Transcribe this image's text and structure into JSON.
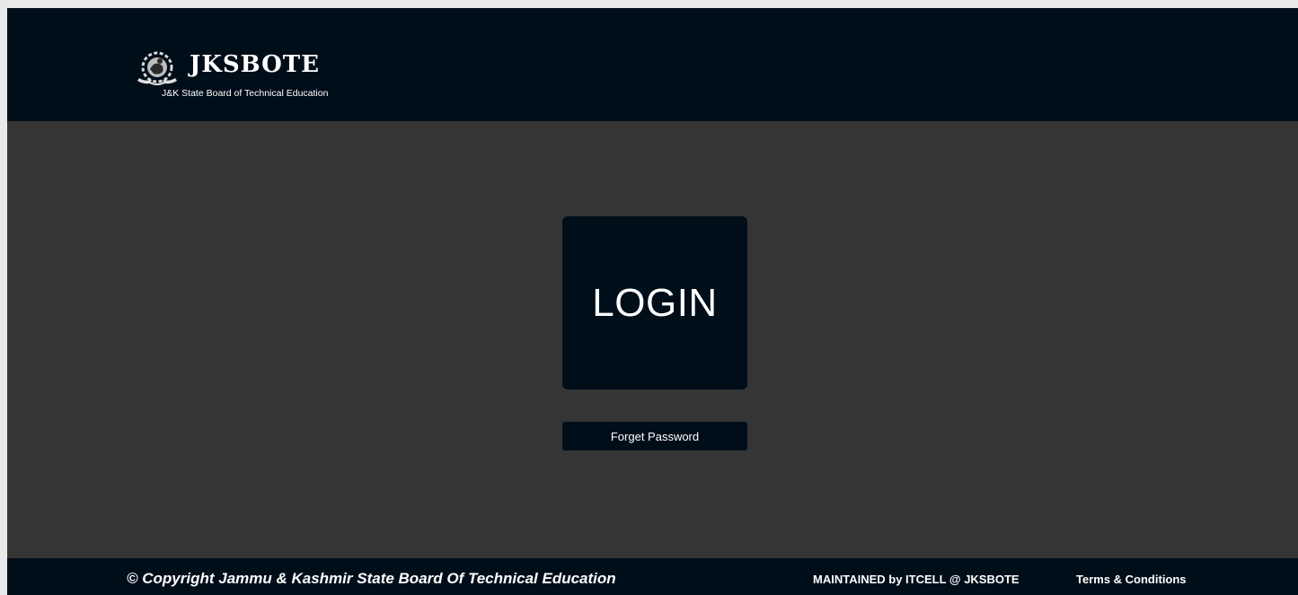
{
  "header": {
    "logo_title": "JKSBOTE",
    "logo_subtitle": "J&K State Board of Technical Education",
    "logo_icon": "emblem-icon"
  },
  "main": {
    "login_label": "LOGIN",
    "forget_password_label": "Forget Password"
  },
  "footer": {
    "copyright": "© Copyright Jammu & Kashmir State Board Of Technical Education",
    "maintained": "MAINTAINED by ITCELL @ JKSBOTE",
    "terms": "Terms & Conditions"
  },
  "colors": {
    "header_bg": "#000e19",
    "body_bg": "#353535",
    "tile_bg": "#000e19",
    "text": "#ffffff"
  }
}
